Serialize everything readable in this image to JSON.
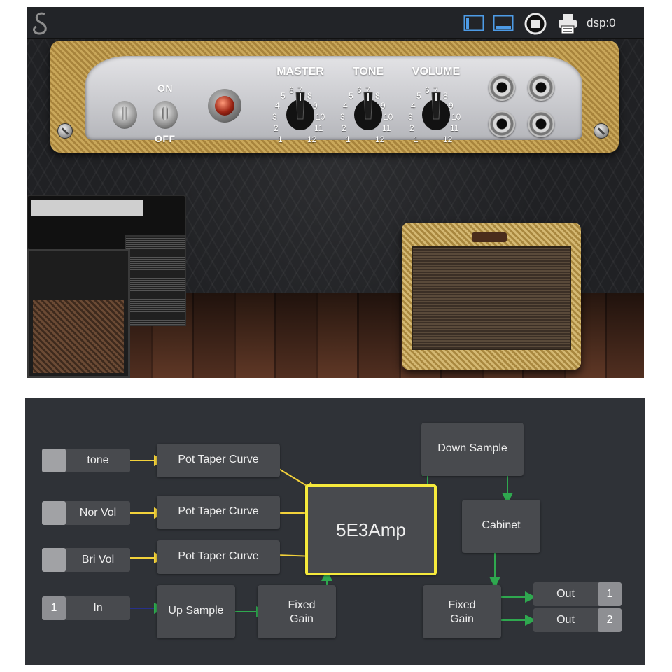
{
  "toolbar": {
    "logo_icon": "app-logo-icon",
    "layout_vertical_icon": "layout-sidebar-icon",
    "layout_horizontal_icon": "layout-bottom-icon",
    "stop_icon": "stop-icon",
    "print_icon": "printer-icon",
    "dsp_text": "dsp:0"
  },
  "amp": {
    "on_label": "ON",
    "off_label": "OFF",
    "knobs": [
      {
        "label": "MASTER"
      },
      {
        "label": "TONE"
      },
      {
        "label": "VOLUME"
      }
    ],
    "knob_numbers": [
      "1",
      "2",
      "3",
      "4",
      "5",
      "6",
      "7",
      "8",
      "9",
      "10",
      "11",
      "12"
    ]
  },
  "graph": {
    "inputs": {
      "tone": "tone",
      "nor_vol": "Nor Vol",
      "bri_vol": "Bri Vol",
      "in": "In",
      "in_number": "1"
    },
    "nodes": {
      "pot1": "Pot Taper Curve",
      "pot2": "Pot Taper Curve",
      "pot3": "Pot Taper Curve",
      "up_sample": "Up Sample",
      "fixed_gain_1_line1": "Fixed",
      "fixed_gain_1_line2": "Gain",
      "amp": "5E3Amp",
      "down_sample": "Down Sample",
      "cabinet": "Cabinet",
      "fixed_gain_2_line1": "Fixed",
      "fixed_gain_2_line2": "Gain"
    },
    "outputs": [
      {
        "label": "Out",
        "number": "1"
      },
      {
        "label": "Out",
        "number": "2"
      }
    ],
    "colors": {
      "background": "#2f3237",
      "node": "#484a4e",
      "amp_border": "#f6ea3c",
      "control_wire": "#f3d23b",
      "audio_wire": "#2fa84f",
      "port_blue": "#27308a"
    }
  }
}
